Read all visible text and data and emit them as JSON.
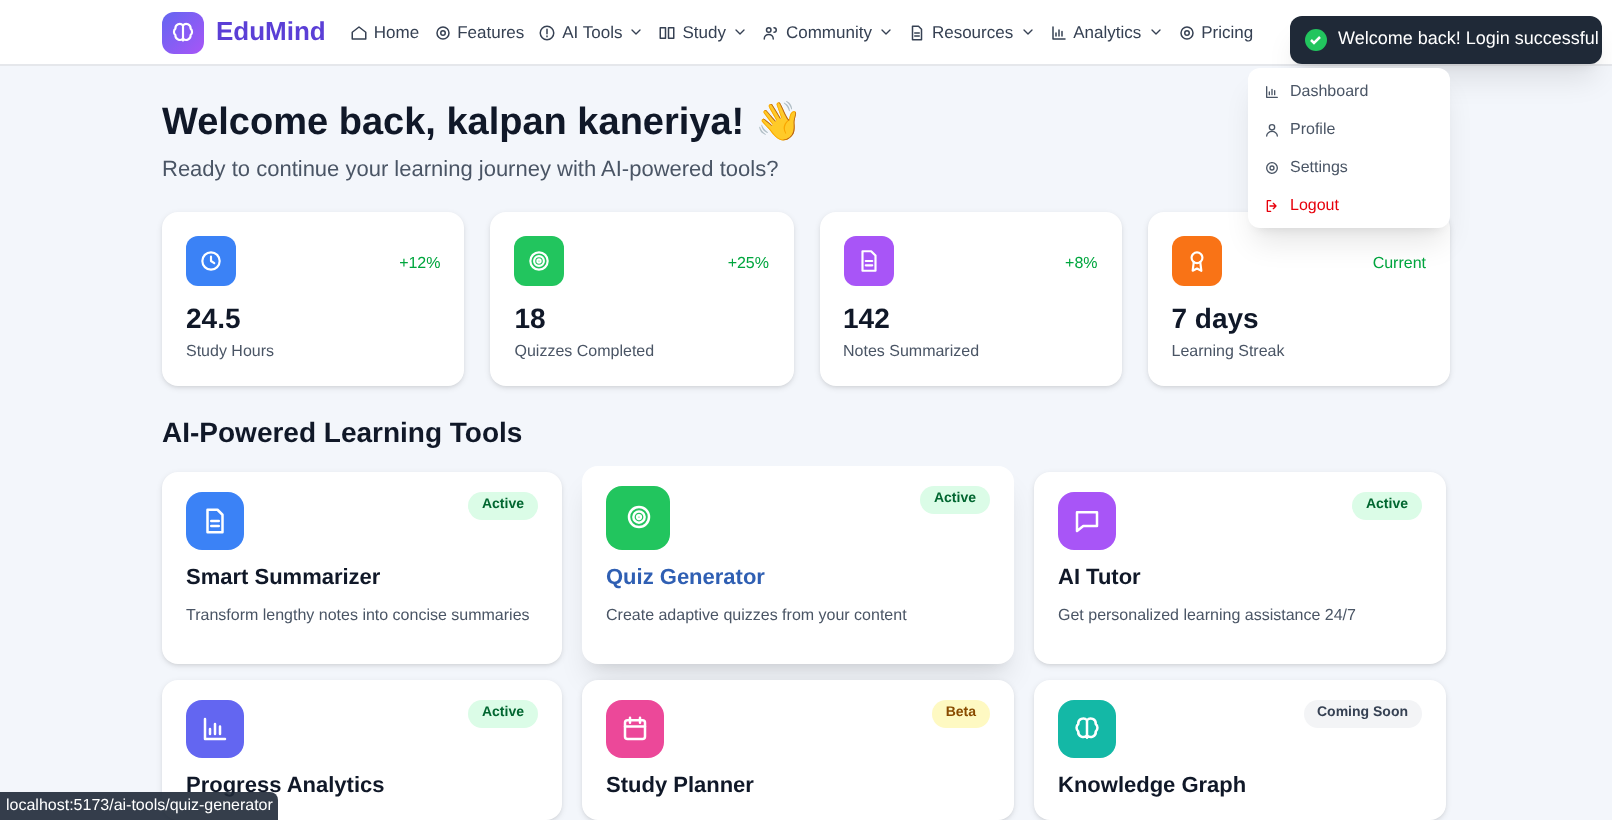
{
  "brand": "EduMind",
  "nav": [
    {
      "label": "Home",
      "dropdown": false
    },
    {
      "label": "Features",
      "dropdown": false
    },
    {
      "label": "AI Tools",
      "dropdown": true
    },
    {
      "label": "Study",
      "dropdown": true
    },
    {
      "label": "Community",
      "dropdown": true
    },
    {
      "label": "Resources",
      "dropdown": true
    },
    {
      "label": "Analytics",
      "dropdown": true
    },
    {
      "label": "Pricing",
      "dropdown": false
    }
  ],
  "toast": {
    "message": "Welcome back! Login successful"
  },
  "user_menu": [
    {
      "label": "Dashboard",
      "kind": "normal"
    },
    {
      "label": "Profile",
      "kind": "normal"
    },
    {
      "label": "Settings",
      "kind": "normal"
    },
    {
      "label": "Logout",
      "kind": "danger"
    }
  ],
  "heading": "Welcome back, kalpan kaneriya! 👋",
  "subheading": "Ready to continue your learning journey with AI-powered tools?",
  "stats": [
    {
      "value": "24.5",
      "label": "Study Hours",
      "change": "+12%",
      "color": "#3b82f6"
    },
    {
      "value": "18",
      "label": "Quizzes Completed",
      "change": "+25%",
      "color": "#22c55e"
    },
    {
      "value": "142",
      "label": "Notes Summarized",
      "change": "+8%",
      "color": "#a855f7"
    },
    {
      "value": "7 days",
      "label": "Learning Streak",
      "change": "Current",
      "color": "#f97316"
    }
  ],
  "tools_heading": "AI-Powered Learning Tools",
  "tools": [
    {
      "title": "Smart Summarizer",
      "description": "Transform lengthy notes into concise summaries",
      "badge": "Active",
      "color": "#3b82f6",
      "hovered": false
    },
    {
      "title": "Quiz Generator",
      "description": "Create adaptive quizzes from your content",
      "badge": "Active",
      "color": "#22c55e",
      "hovered": true
    },
    {
      "title": "AI Tutor",
      "description": "Get personalized learning assistance 24/7",
      "badge": "Active",
      "color": "#a855f7",
      "hovered": false
    },
    {
      "title": "Progress Analytics",
      "badge": "Active",
      "color": "#6366f1",
      "hovered": false
    },
    {
      "title": "Study Planner",
      "badge": "Beta",
      "color": "#ec4899",
      "hovered": false
    },
    {
      "title": "Knowledge Graph",
      "badge": "Coming Soon",
      "color": "#14b8a6",
      "hovered": false
    }
  ],
  "status_url": "localhost:5173/ai-tools/quiz-generator"
}
